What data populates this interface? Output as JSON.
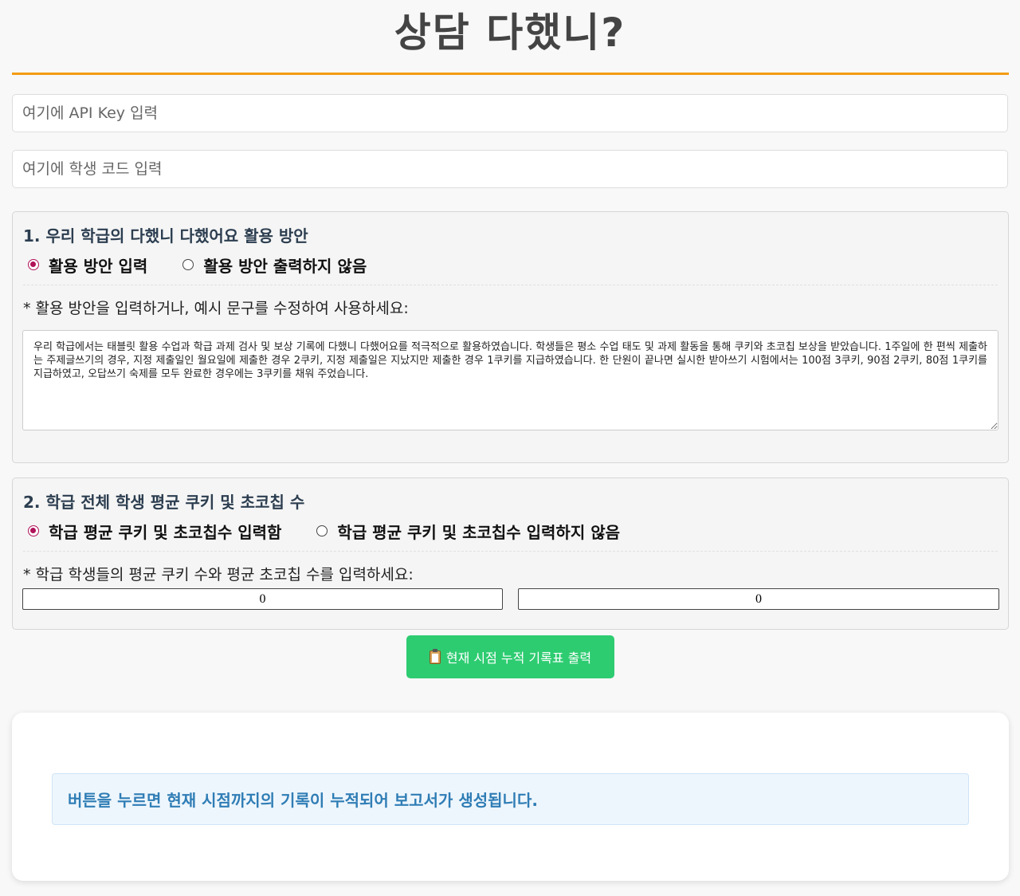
{
  "header": {
    "title": "상담 다했니?"
  },
  "inputs": {
    "api_key_placeholder": "여기에 API Key 입력",
    "student_code_placeholder": "여기에 학생 코드 입력"
  },
  "section1": {
    "title": "1. 우리 학급의 다했니 다했어요 활용 방안",
    "options": [
      {
        "label": "활용 방안 입력",
        "selected": true
      },
      {
        "label": "활용 방안 출력하지 않음",
        "selected": false
      }
    ],
    "instruction": "* 활용 방안을 입력하거나, 예시 문구를 수정하여 사용하세요:",
    "plan_text": "우리 학급에서는 태블릿 활용 수업과 학급 과제 검사 및 보상 기록에 다했니 다했어요를 적극적으로 활용하였습니다. 학생들은 평소 수업 태도 및 과제 활동을 통해 쿠키와 초코칩 보상을 받았습니다. 1주일에 한 편씩 제출하는 주제글쓰기의 경우, 지정 제출일인 월요일에 제출한 경우 2쿠키, 지정 제출일은 지났지만 제출한 경우 1쿠키를 지급하였습니다. 한 단원이 끝나면 실시한 받아쓰기 시험에서는 100점 3쿠키, 90점 2쿠키, 80점 1쿠키를 지급하였고, 오답쓰기 숙제를 모두 완료한 경우에는 3쿠키를 채워 주었습니다."
  },
  "section2": {
    "title": "2. 학급 전체 학생 평균 쿠키 및 초코칩 수",
    "options": [
      {
        "label": "학급 평균 쿠키 및 초코칩수 입력함",
        "selected": true
      },
      {
        "label": "학급 평균 쿠키 및 초코칩수 입력하지 않음",
        "selected": false
      }
    ],
    "instruction": "* 학급 학생들의 평균 쿠키 수와 평균 초코칩 수를 입력하세요:",
    "avg_cookie": "0",
    "avg_choco": "0"
  },
  "actions": {
    "print_label": "현재 시점 누적 기록표 출력",
    "print_icon": "clipboard-icon"
  },
  "report": {
    "info": "버튼을 누르면 현재 시점까지의 기록이 누적되어 보고서가 생성됩니다."
  },
  "colors": {
    "accent": "#f39c12",
    "button": "#2ecc71",
    "radio": "#b0125a",
    "info_text": "#2f7db5"
  }
}
